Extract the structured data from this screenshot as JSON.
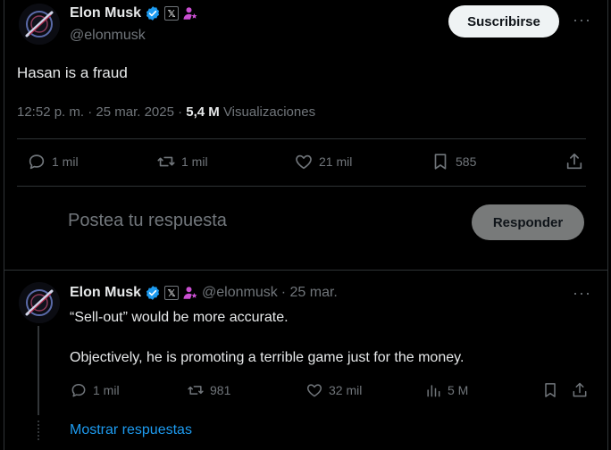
{
  "main_tweet": {
    "author_name": "Elon Musk",
    "author_handle": "@elonmusk",
    "org_badge": "𝕏",
    "subscribe_label": "Suscribirse",
    "more_label": "···",
    "text": "Hasan is a fraud",
    "timestamp": "12:52 p. m. · 25 mar. 2025 · ",
    "views_count": "5,4 M",
    "views_label": " Visualizaciones",
    "replies": "1 mil",
    "reposts": "1 mil",
    "likes": "21 mil",
    "bookmarks": "585",
    "icons": {
      "reply": "reply-icon",
      "repost": "repost-icon",
      "like": "heart-icon",
      "bookmark": "bookmark-icon",
      "share": "share-icon"
    }
  },
  "composer": {
    "placeholder": "Postea tu respuesta",
    "button_label": "Responder"
  },
  "reply_tweet": {
    "author_name": "Elon Musk",
    "author_handle": "@elonmusk",
    "date": "· 25 mar.",
    "org_badge": "𝕏",
    "more_label": "···",
    "line1": "“Sell-out” would be more accurate.",
    "line2": "Objectively, he is promoting a terrible game just for the money.",
    "replies": "1 mil",
    "reposts": "981",
    "likes": "32 mil",
    "views": "5 M",
    "show_replies": "Mostrar respuestas"
  },
  "colors": {
    "background": "#000000",
    "text": "#e7e9ea",
    "muted": "#71767b",
    "accent": "#1d9bf0",
    "affiliate": "#c94fd1",
    "border": "#2f3336"
  }
}
